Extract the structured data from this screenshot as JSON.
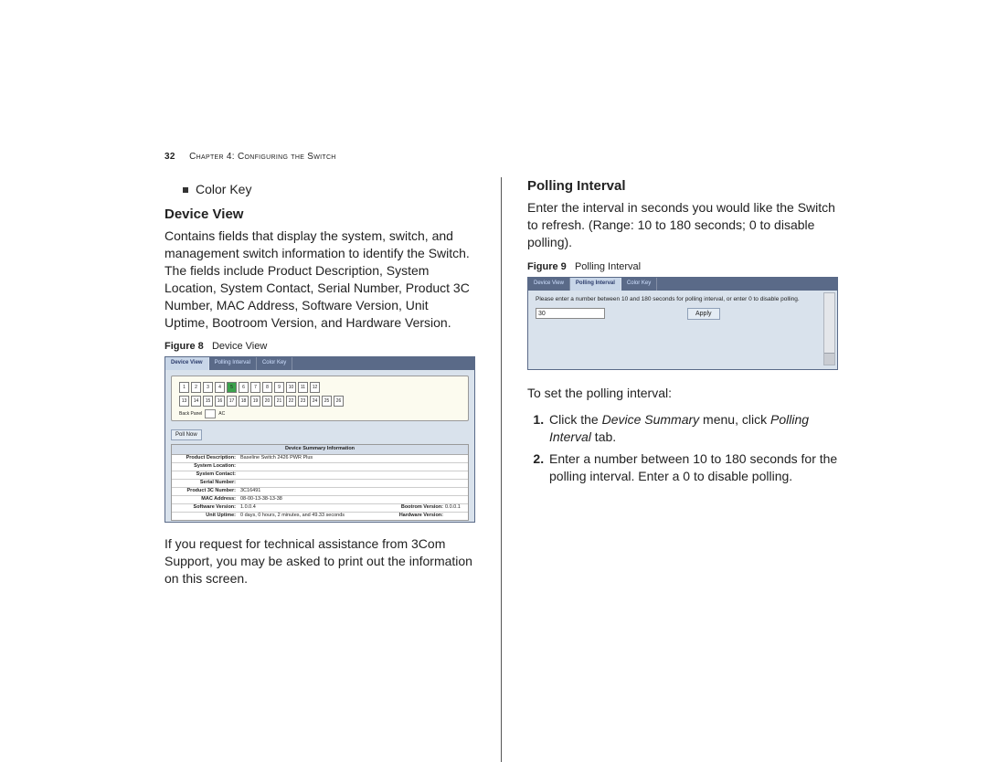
{
  "header": {
    "page_number": "32",
    "chapter_label": "Chapter 4: Configuring the Switch"
  },
  "left": {
    "bullet": "Color Key",
    "h_device_view": "Device View",
    "p_device_view": "Contains fields that display the system, switch, and management switch information to identify the Switch. The fields include Product Description, System Location, System Contact, Serial Number, Product 3C Number, MAC Address, Software Version, Unit Uptime, Bootroom Version, and Hardware Version.",
    "fig8_label": "Figure 8",
    "fig8_title": "Device View",
    "p_note": "If you request for technical assistance from 3Com Support, you may be asked to print out the information on this screen."
  },
  "right": {
    "h_polling": "Polling Interval",
    "p_polling": "Enter the interval in seconds you would like the Switch to refresh. (Range: 10 to 180 seconds; 0 to disable polling).",
    "fig9_label": "Figure 9",
    "fig9_title": "Polling Interval",
    "p_to_set": "To set the polling interval:",
    "step1_a": "Click the ",
    "step1_em1": "Device Summary",
    "step1_b": " menu, click ",
    "step1_em2": "Polling Interval",
    "step1_c": " tab.",
    "step2": "Enter a number between 10 to 180 seconds for the polling interval. Enter a 0 to disable polling."
  },
  "shotA": {
    "tabs": [
      "Device View",
      "Polling Interval",
      "Color Key"
    ],
    "active_tab": 0,
    "ports_row1": [
      "1",
      "2",
      "3",
      "4",
      "5",
      "6",
      "7",
      "8",
      "9",
      "10",
      "11",
      "12"
    ],
    "ports_row2": [
      "13",
      "14",
      "15",
      "16",
      "17",
      "18",
      "19",
      "20",
      "21",
      "22",
      "23",
      "24",
      "25",
      "26"
    ],
    "port_on_index": 4,
    "back_panel_label": "Back Panel",
    "ac_label": "AC",
    "poll_now": "Poll Now",
    "summary_header": "Device Summary Information",
    "rows": [
      {
        "label": "Product Description:",
        "value": "Baseline Switch 2426 PWR Plus"
      },
      {
        "label": "System Location:",
        "value": ""
      },
      {
        "label": "System Contact:",
        "value": ""
      },
      {
        "label": "Serial Number:",
        "value": ""
      },
      {
        "label": "Product 3C Number:",
        "value": "3C16491"
      },
      {
        "label": "MAC Address:",
        "value": "08-00-13-38-13-38"
      },
      {
        "label": "Software Version:",
        "value": "1.0.0.4",
        "rlabel": "Bootrom Version:",
        "rvalue": "0.0.0.1"
      },
      {
        "label": "Unit Uptime:",
        "value": "0 days, 0 hours, 2 minutes, and 49.33 seconds",
        "rlabel": "Hardware Version:",
        "rvalue": ""
      }
    ]
  },
  "shotB": {
    "tabs": [
      "Device View",
      "Polling Interval",
      "Color Key"
    ],
    "active_tab": 1,
    "message": "Please enter a number between 10 and 180 seconds for polling interval, or enter 0 to disable polling.",
    "input_value": "30",
    "apply_label": "Apply"
  }
}
